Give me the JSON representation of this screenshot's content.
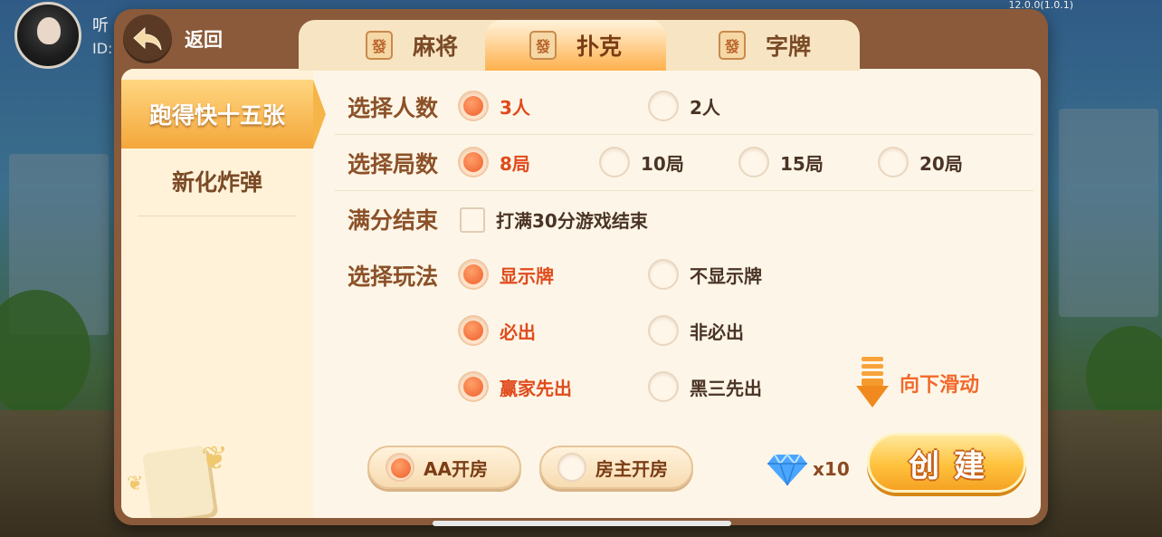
{
  "status": {
    "version": "12.0.0(1.0.1)"
  },
  "user": {
    "name": "听",
    "id_label": "ID:"
  },
  "header": {
    "back_label": "返回"
  },
  "tabs": [
    {
      "icon": "發",
      "label": "麻将"
    },
    {
      "icon": "發",
      "label": "扑克"
    },
    {
      "icon": "發",
      "label": "字牌"
    }
  ],
  "sidebar": {
    "items": [
      {
        "label": "跑得快十五张"
      },
      {
        "label": "新化炸弹"
      }
    ]
  },
  "rules": {
    "players": {
      "label": "选择人数",
      "options": [
        "3人",
        "2人"
      ],
      "selected": "3人"
    },
    "rounds": {
      "label": "选择局数",
      "options": [
        "8局",
        "10局",
        "15局",
        "20局"
      ],
      "selected": "8局"
    },
    "score_end": {
      "label": "满分结束",
      "checkbox_label": "打满30分游戏结束",
      "checked": false
    },
    "play_mode": {
      "label": "选择玩法",
      "groups": [
        {
          "options": [
            "显示牌",
            "不显示牌"
          ],
          "selected": "显示牌"
        },
        {
          "options": [
            "必出",
            "非必出"
          ],
          "selected": "必出"
        },
        {
          "options": [
            "赢家先出",
            "黑三先出"
          ],
          "selected": "赢家先出"
        }
      ]
    }
  },
  "scroll_hint": {
    "label": "向下滑动"
  },
  "footer": {
    "pay_options": [
      "AA开房",
      "房主开房"
    ],
    "pay_selected": "AA开房",
    "cost_label": "x10",
    "create_label": "创建"
  },
  "colors": {
    "accent": "#ee5f2b",
    "panel": "#fdf6e8",
    "frame": "#8b5a3a",
    "create": "#ffc23d"
  }
}
